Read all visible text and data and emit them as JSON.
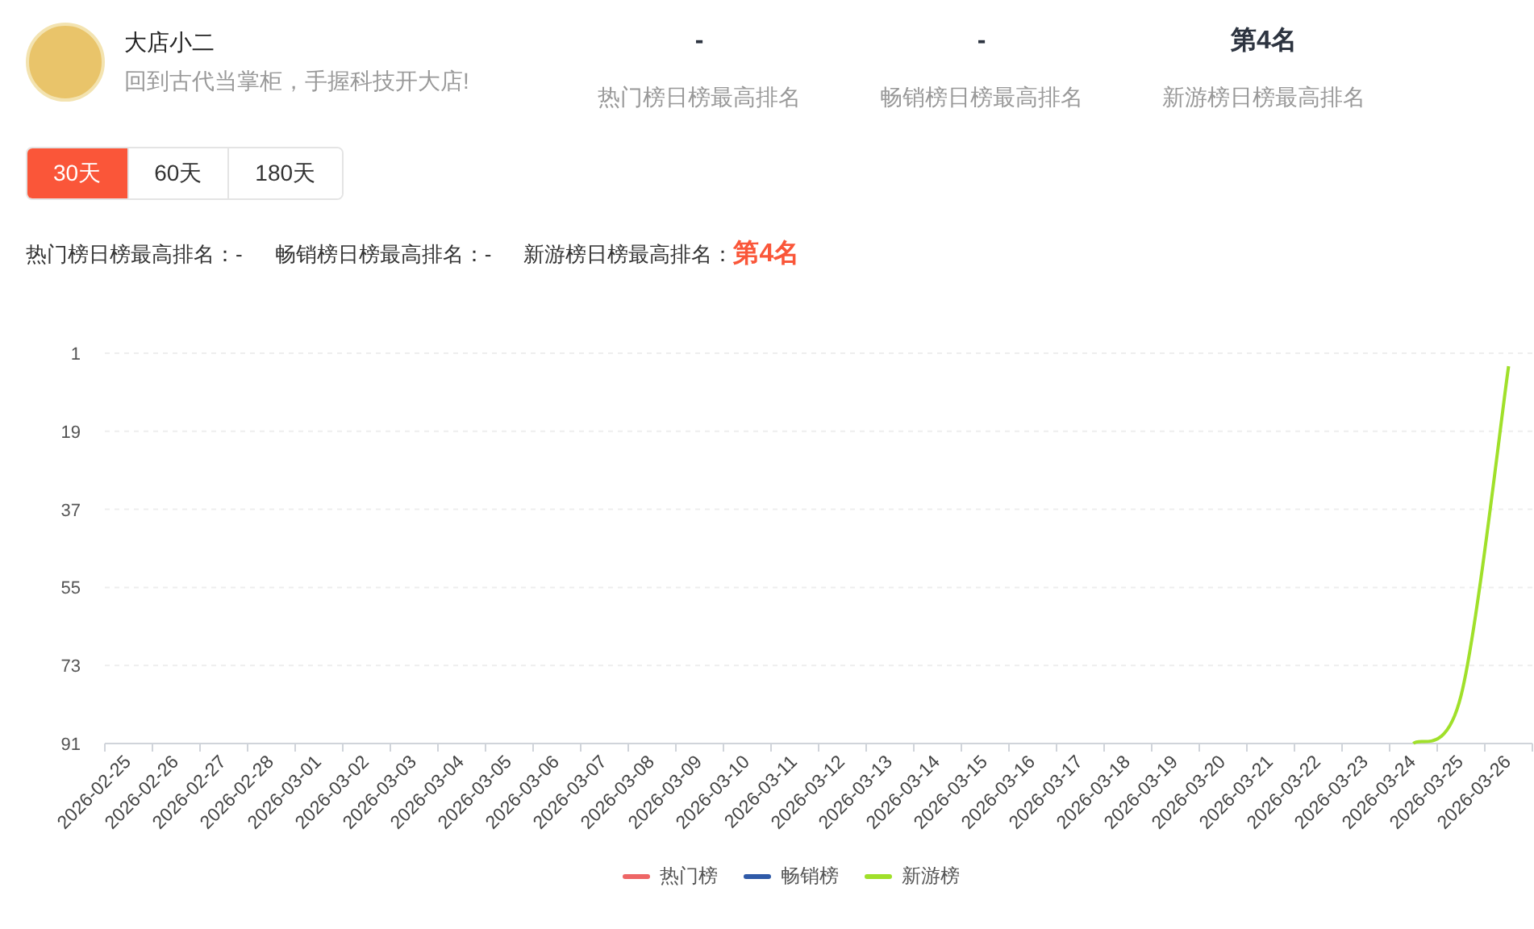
{
  "profile": {
    "name": "大店小二",
    "tagline": "回到古代当掌柜，手握科技开大店!"
  },
  "stats": [
    {
      "value": "-",
      "label": "热门榜日榜最高排名"
    },
    {
      "value": "-",
      "label": "畅销榜日榜最高排名"
    },
    {
      "value": "第4名",
      "label": "新游榜日榜最高排名"
    }
  ],
  "tabs": [
    {
      "label": "30天",
      "selected": true
    },
    {
      "label": "60天",
      "selected": false
    },
    {
      "label": "180天",
      "selected": false
    }
  ],
  "summary": [
    {
      "label": "热门榜日榜最高排名：",
      "value": "-",
      "highlight": false
    },
    {
      "label": "畅销榜日榜最高排名：",
      "value": "-",
      "highlight": false
    },
    {
      "label": "新游榜日榜最高排名：",
      "value": "第4名",
      "highlight": true
    }
  ],
  "chart_data": {
    "type": "line",
    "categories": [
      "2026-02-25",
      "2026-02-26",
      "2026-02-27",
      "2026-02-28",
      "2026-03-01",
      "2026-03-02",
      "2026-03-03",
      "2026-03-04",
      "2026-03-05",
      "2026-03-06",
      "2026-03-07",
      "2026-03-08",
      "2026-03-09",
      "2026-03-10",
      "2026-03-11",
      "2026-03-12",
      "2026-03-13",
      "2026-03-14",
      "2026-03-15",
      "2026-03-16",
      "2026-03-17",
      "2026-03-18",
      "2026-03-19",
      "2026-03-20",
      "2026-03-21",
      "2026-03-22",
      "2026-03-23",
      "2026-03-24",
      "2026-03-25",
      "2026-03-26"
    ],
    "grid": true,
    "ylim": [
      91,
      1
    ],
    "yticks": [
      1,
      19,
      37,
      55,
      73,
      91
    ],
    "series": [
      {
        "name": "热门榜",
        "color": "#ee6666",
        "values": [
          null,
          null,
          null,
          null,
          null,
          null,
          null,
          null,
          null,
          null,
          null,
          null,
          null,
          null,
          null,
          null,
          null,
          null,
          null,
          null,
          null,
          null,
          null,
          null,
          null,
          null,
          null,
          null,
          null,
          null
        ]
      },
      {
        "name": "畅销榜",
        "color": "#2f5aa8",
        "values": [
          null,
          null,
          null,
          null,
          null,
          null,
          null,
          null,
          null,
          null,
          null,
          null,
          null,
          null,
          null,
          null,
          null,
          null,
          null,
          null,
          null,
          null,
          null,
          null,
          null,
          null,
          null,
          null,
          null,
          null
        ]
      },
      {
        "name": "新游榜",
        "color": "#a0e02a",
        "values": [
          null,
          null,
          null,
          null,
          null,
          null,
          null,
          null,
          null,
          null,
          null,
          null,
          null,
          null,
          null,
          null,
          null,
          null,
          null,
          null,
          null,
          null,
          null,
          null,
          null,
          null,
          null,
          91,
          80,
          4
        ]
      }
    ]
  }
}
